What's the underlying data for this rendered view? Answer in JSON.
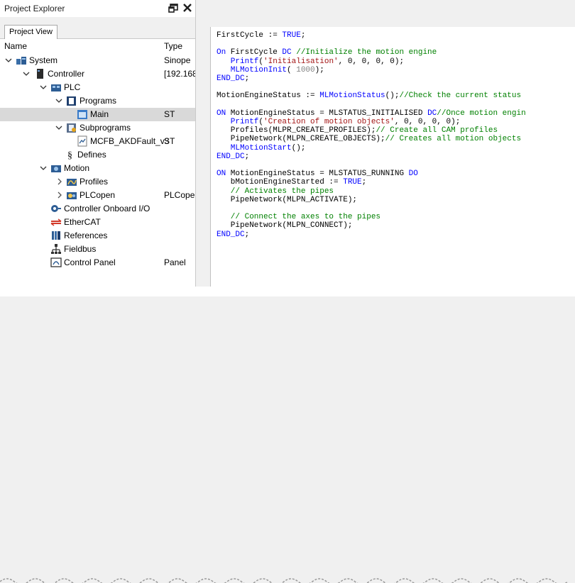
{
  "explorer": {
    "title": "Project Explorer",
    "tab_label": "Project View",
    "col_name": "Name",
    "col_type": "Type"
  },
  "tree": [
    {
      "label": "System",
      "type": "Sinope",
      "icon": "system-icon",
      "chevron": "expanded"
    },
    {
      "label": "Controller",
      "type": "[192.168",
      "icon": "controller-icon",
      "chevron": "expanded"
    },
    {
      "label": "PLC",
      "type": "",
      "icon": "plc-icon",
      "chevron": "expanded"
    },
    {
      "label": "Programs",
      "type": "",
      "icon": "programs-folder-icon",
      "chevron": "expanded"
    },
    {
      "label": "Main",
      "type": "ST",
      "icon": "program-icon",
      "chevron": "none",
      "selected": true
    },
    {
      "label": "Subprograms",
      "type": "",
      "icon": "subprograms-folder-icon",
      "chevron": "expanded"
    },
    {
      "label": "MCFB_AKDFault_v3",
      "type": "ST",
      "icon": "subprogram-file-icon",
      "chevron": "none"
    },
    {
      "label": "Defines",
      "type": "",
      "icon": "defines-icon",
      "chevron": "none"
    },
    {
      "label": "Motion",
      "type": "",
      "icon": "motion-icon",
      "chevron": "expanded"
    },
    {
      "label": "Profiles",
      "type": "",
      "icon": "profiles-icon",
      "chevron": "collapsed"
    },
    {
      "label": "PLCopen",
      "type": "PLCoper",
      "icon": "plcopen-icon",
      "chevron": "collapsed"
    },
    {
      "label": "Controller Onboard I/O",
      "type": "",
      "icon": "onboard-io-icon",
      "chevron": "none"
    },
    {
      "label": "EtherCAT",
      "type": "",
      "icon": "ethercat-icon",
      "chevron": "none"
    },
    {
      "label": "References",
      "type": "",
      "icon": "references-icon",
      "chevron": "none"
    },
    {
      "label": "Fieldbus",
      "type": "",
      "icon": "fieldbus-icon",
      "chevron": "none"
    },
    {
      "label": "Control Panel",
      "type": "Panel",
      "icon": "control-panel-icon",
      "chevron": "none"
    }
  ],
  "code": [
    [
      [
        "FirstCycle := ",
        ""
      ],
      [
        "TRUE",
        "kw"
      ],
      [
        ";",
        ""
      ]
    ],
    [],
    [
      [
        "On",
        "kw"
      ],
      [
        " FirstCycle ",
        ""
      ],
      [
        "DC",
        "kw"
      ],
      [
        " //Initialize the motion engine",
        "cm"
      ]
    ],
    [
      [
        "   Printf",
        "fn"
      ],
      [
        "(",
        ""
      ],
      [
        "'Initialisation'",
        "st"
      ],
      [
        ", 0, 0, 0, 0);",
        ""
      ]
    ],
    [
      [
        "   MLMotionInit",
        "fn"
      ],
      [
        "( ",
        ""
      ],
      [
        "1000",
        "nm"
      ],
      [
        ");",
        ""
      ]
    ],
    [
      [
        "END_DC",
        "kw"
      ],
      [
        ";",
        ""
      ]
    ],
    [],
    [
      [
        "MotionEngineStatus := ",
        ""
      ],
      [
        "MLMotionStatus",
        "fn"
      ],
      [
        "();",
        ""
      ],
      [
        "//Check the current status",
        "cm"
      ]
    ],
    [],
    [
      [
        "ON",
        "kw"
      ],
      [
        " MotionEngineStatus = MLSTATUS_INITIALISED ",
        ""
      ],
      [
        "DC",
        "kw"
      ],
      [
        "//Once motion engin",
        "cm"
      ]
    ],
    [
      [
        "   Printf",
        "fn"
      ],
      [
        "(",
        ""
      ],
      [
        "'Creation of motion objects'",
        "st"
      ],
      [
        ", 0, 0, 0, 0);",
        ""
      ]
    ],
    [
      [
        "   Profiles(MLPR_CREATE_PROFILES);",
        ""
      ],
      [
        "// Create all CAM profiles",
        "cm"
      ]
    ],
    [
      [
        "   PipeNetwork(MLPN_CREATE_OBJECTS);",
        ""
      ],
      [
        "// Creates all motion objects",
        "cm"
      ]
    ],
    [
      [
        "   MLMotionStart",
        "fn"
      ],
      [
        "();",
        ""
      ]
    ],
    [
      [
        "END_DC",
        "kw"
      ],
      [
        ";",
        ""
      ]
    ],
    [],
    [
      [
        "ON",
        "kw"
      ],
      [
        " MotionEngineStatus = MLSTATUS_RUNNING ",
        ""
      ],
      [
        "DO",
        "kw"
      ]
    ],
    [
      [
        "   bMotionEngineStarted := ",
        ""
      ],
      [
        "TRUE",
        "kw"
      ],
      [
        ";",
        ""
      ]
    ],
    [
      [
        "   // Activates the pipes",
        "cm"
      ]
    ],
    [
      [
        "   PipeNetwork(MLPN_ACTIVATE);",
        ""
      ]
    ],
    [],
    [
      [
        "   // Connect the axes to the pipes",
        "cm"
      ]
    ],
    [
      [
        "   PipeNetwork(MLPN_CONNECT);",
        ""
      ]
    ],
    [
      [
        "END_DC",
        "kw"
      ],
      [
        ";",
        ""
      ]
    ]
  ]
}
